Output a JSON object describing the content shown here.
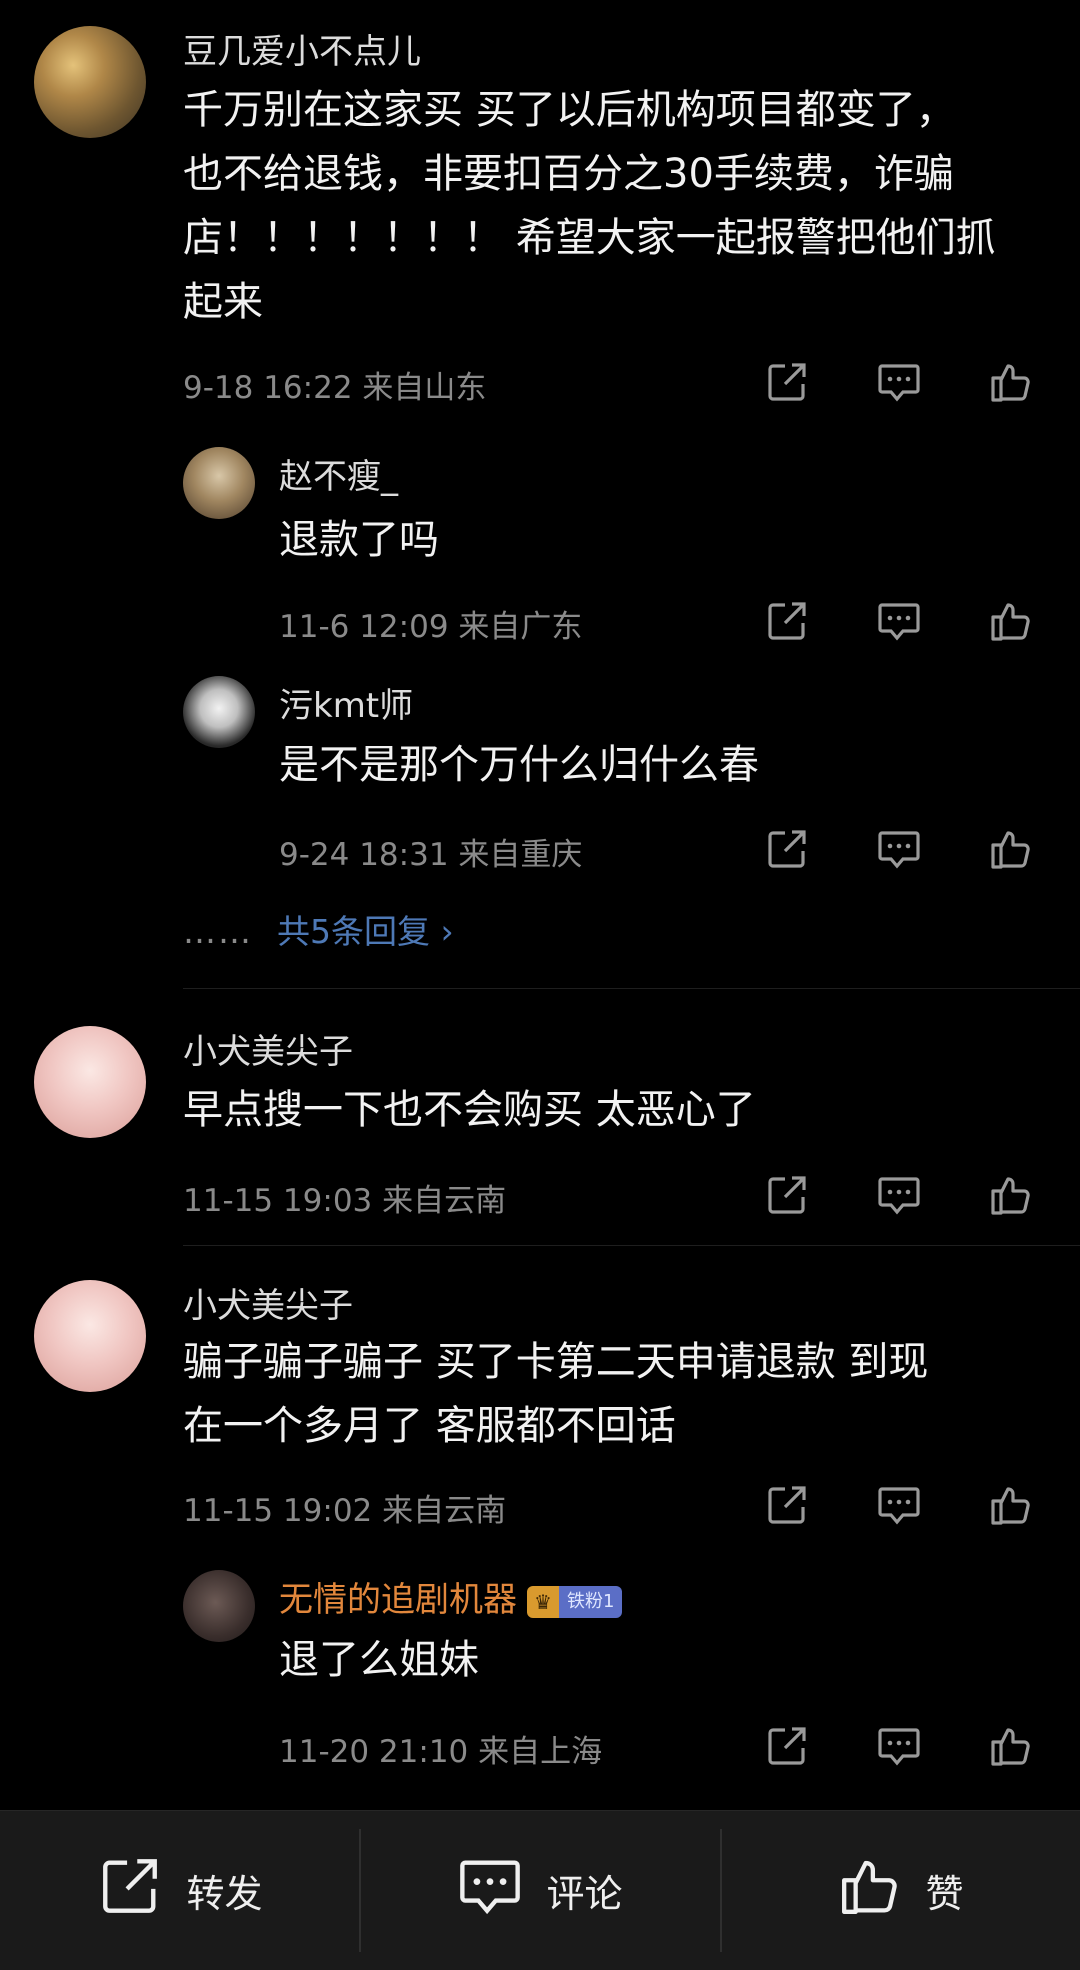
{
  "comments": [
    {
      "user": "豆几爱小不点儿",
      "lines": [
        "千万别在这家买 买了以后机构项目都变了，",
        "也不给退钱，非要扣百分之30手续费，诈骗",
        "店！！！！！！！ 希望大家一起报警把他们抓",
        "起来"
      ],
      "meta": "9-18 16:22  来自山东",
      "replies": [
        {
          "user": "赵不瘦_",
          "text": "退款了吗",
          "meta": "11-6 12:09  来自广东"
        },
        {
          "user": "污kmt师",
          "text": "是不是那个万什么归什么春",
          "meta": "9-24 18:31  来自重庆"
        }
      ],
      "more": {
        "dots": "……",
        "label": "共5条回复 ›"
      }
    },
    {
      "user": "小犬美尖子",
      "lines": [
        "早点搜一下也不会购买 太恶心了"
      ],
      "meta": "11-15 19:03  来自云南"
    },
    {
      "user": "小犬美尖子",
      "lines": [
        "骗子骗子骗子 买了卡第二天申请退款 到现",
        "在一个多月了 客服都不回话"
      ],
      "meta": "11-15 19:02  来自云南",
      "replies": [
        {
          "user": "无情的追剧机器",
          "badge": "铁粉1",
          "text": "退了么姐妹",
          "meta": "11-20 21:10  来自上海"
        }
      ]
    }
  ],
  "bottom_bar": {
    "repost": "转发",
    "comment": "评论",
    "like": "赞"
  },
  "colors": {
    "background": "#000000",
    "username_highlight": "#e2873c",
    "link": "#4e79b6"
  },
  "icons": [
    "share-icon",
    "comment-icon",
    "like-icon",
    "crown-icon"
  ]
}
